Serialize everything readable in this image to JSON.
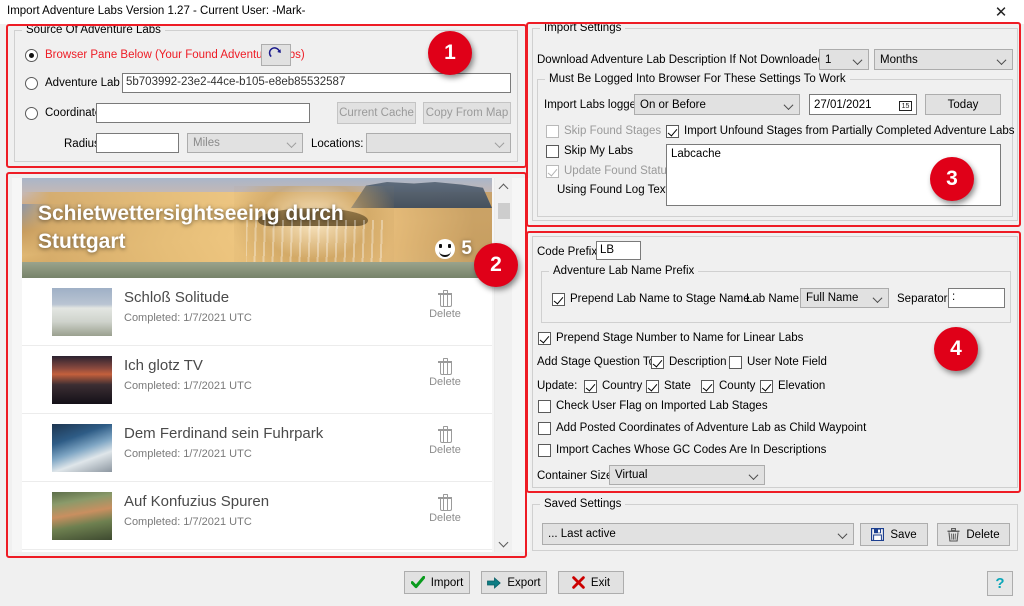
{
  "window": {
    "title": "Import Adventure Labs Version 1.27 - Current User: -Mark-",
    "close_label": "✕"
  },
  "annotations": {
    "badge1": "1",
    "badge2": "2",
    "badge3": "3",
    "badge4": "4"
  },
  "source_panel": {
    "group_title": "Source Of Adventure Labs",
    "radio_browser_label": "Browser Pane Below (Your Found Adventure Labs)",
    "refresh_icon": "refresh-icon",
    "radio_labid_label": "Adventure Lab ID:",
    "labid_value": "5b703992-23e2-44ce-b105-e8eb85532587",
    "radio_coords_label": "Coordinates:",
    "coords_value": "",
    "btn_current_cache": "Current Cache",
    "btn_copy_from_map": "Copy From Map",
    "radius_label": "Radius:",
    "radius_value": "",
    "units_value": "Miles",
    "locations_label": "Locations:",
    "locations_value": ""
  },
  "browser_pane": {
    "hero_title": "Schietwettersightseeing durch Stuttgart",
    "favorites_count": "5",
    "favorites_icon": "smiley-icon",
    "stages": [
      {
        "name": "Schloß Solitude",
        "status": "Completed: 1/7/2021 UTC",
        "delete_label": "Delete"
      },
      {
        "name": "Ich glotz TV",
        "status": "Completed: 1/7/2021 UTC",
        "delete_label": "Delete"
      },
      {
        "name": "Dem Ferdinand sein Fuhrpark",
        "status": "Completed: 1/7/2021 UTC",
        "delete_label": "Delete"
      },
      {
        "name": "Auf Konfuzius Spuren",
        "status": "Completed: 1/7/2021 UTC",
        "delete_label": "Delete"
      }
    ]
  },
  "import_settings": {
    "group_title": "Import Settings",
    "download_desc_label": "Download Adventure Lab Description If Not Downloaded In Last",
    "download_count": "1",
    "download_unit": "Months",
    "logged_group_title": "Must Be Logged Into Browser For These Settings To Work",
    "import_labs_logged_label": "Import Labs logged",
    "logged_comparison": "On or Before",
    "logged_date": "27/01/2021",
    "btn_today": "Today",
    "cb_skip_found_stages": "Skip Found Stages",
    "cb_skip_my_labs": "Skip My Labs",
    "cb_update_found_status": "Update Found Status",
    "cb_import_unfound": "Import Unfound Stages from Partially Completed Adventure Labs",
    "using_found_log_label": "Using Found Log Text:",
    "found_log_text": "Labcache"
  },
  "naming_panel": {
    "code_prefix_label": "Code Prefix:",
    "code_prefix_value": "LB",
    "name_prefix_group": "Adventure Lab Name Prefix",
    "cb_prepend_lab_name": "Prepend Lab Name to Stage Name",
    "lab_name_label": "Lab Name:",
    "lab_name_value": "Full Name",
    "separator_label": "Separator:",
    "separator_value": ":",
    "cb_prepend_stage_number": "Prepend Stage Number to Name for Linear Labs",
    "add_stage_question_label": "Add Stage Question To:",
    "cb_description": "Description",
    "cb_user_note_field": "User Note Field",
    "update_label": "Update:",
    "cb_country": "Country",
    "cb_state": "State",
    "cb_county": "County",
    "cb_elevation": "Elevation",
    "cb_check_user_flag": "Check User Flag on Imported Lab Stages",
    "cb_add_posted_coords": "Add Posted Coordinates of Adventure Lab as Child Waypoint",
    "cb_import_gc_codes": "Import Caches Whose GC Codes Are In Descriptions",
    "container_size_label": "Container Size:",
    "container_size_value": "Virtual"
  },
  "saved_settings": {
    "group_title": "Saved Settings",
    "selected": "... Last active",
    "btn_save": "Save",
    "btn_delete": "Delete"
  },
  "footer": {
    "btn_import": "Import",
    "btn_export": "Export",
    "btn_exit": "Exit",
    "btn_help": "?"
  }
}
